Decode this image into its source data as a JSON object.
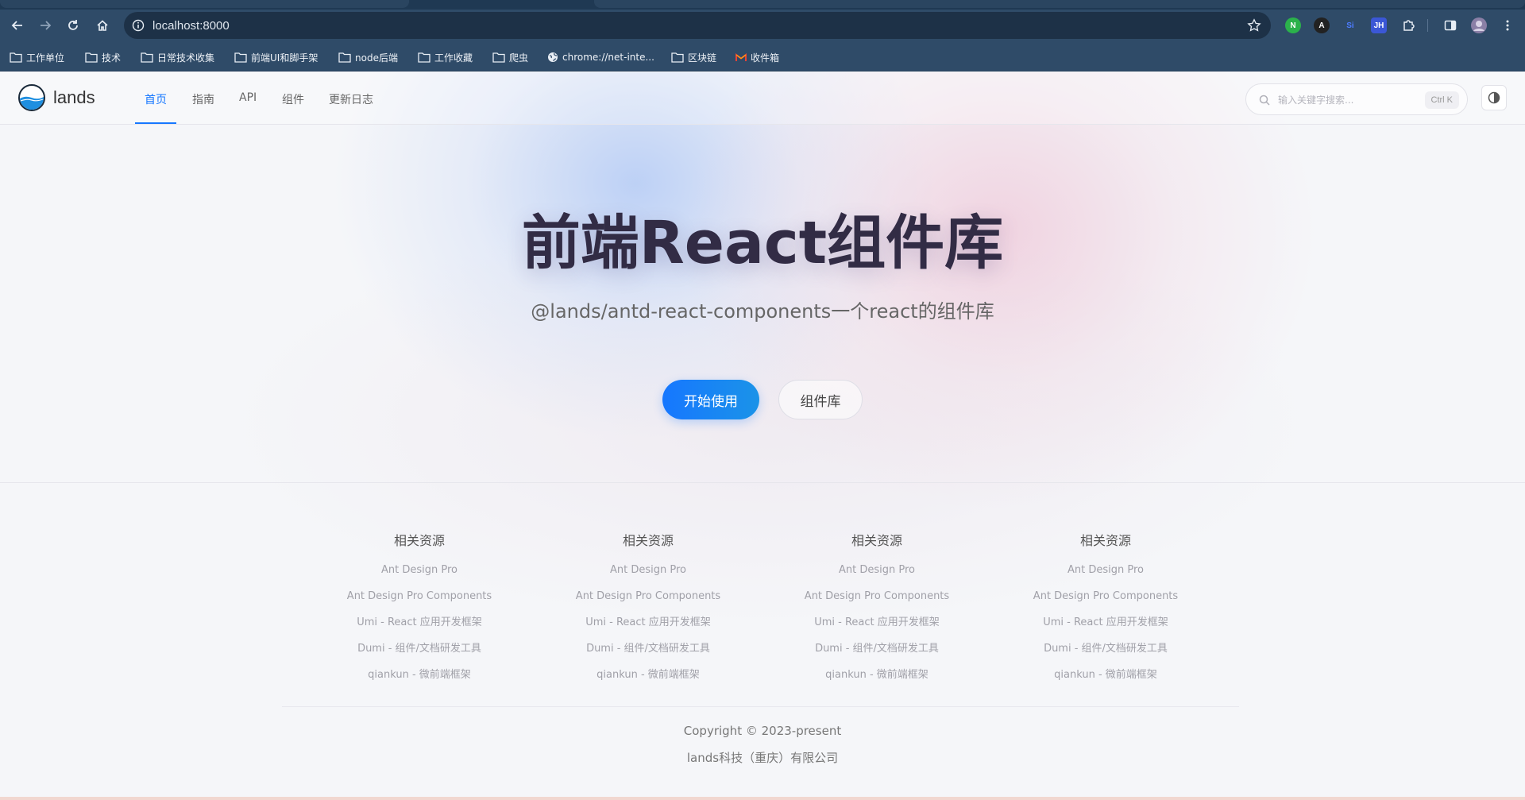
{
  "browser": {
    "url": "localhost:8000",
    "extensions": [
      {
        "icon": "extension-green-icon",
        "label": "N",
        "color": "#2bb14b"
      },
      {
        "icon": "extension-dark-icon",
        "label": "A",
        "color": "#222222"
      },
      {
        "icon": "extension-si-icon",
        "label": "Si",
        "color": "#2f4b68"
      },
      {
        "icon": "extension-jh-icon",
        "label": "JH",
        "color": "#3b57d6"
      }
    ]
  },
  "bookmarks": [
    {
      "label": "工作单位"
    },
    {
      "label": "技术"
    },
    {
      "label": "日常技术收集"
    },
    {
      "label": "前端UI和脚手架"
    },
    {
      "label": "node后端"
    },
    {
      "label": "工作收藏"
    },
    {
      "label": "爬虫"
    },
    {
      "label": "chrome://net-inte..."
    },
    {
      "label": "区块链"
    },
    {
      "label": "收件箱"
    }
  ],
  "nav": {
    "brand": "lands",
    "items": [
      {
        "label": "首页"
      },
      {
        "label": "指南"
      },
      {
        "label": "API"
      },
      {
        "label": "组件"
      },
      {
        "label": "更新日志"
      }
    ],
    "search": {
      "placeholder": "输入关键字搜索...",
      "shortcut": "Ctrl K"
    }
  },
  "hero": {
    "title": "前端React组件库",
    "subtitle": "@lands/antd-react-components一个react的组件库",
    "primary_button": "开始使用",
    "secondary_button": "组件库"
  },
  "footer": {
    "columns": [
      {
        "title": "相关资源",
        "links": [
          "Ant Design Pro",
          "Ant Design Pro Components",
          "Umi - React 应用开发框架",
          "Dumi - 组件/文档研发工具",
          "qiankun - 微前端框架"
        ]
      },
      {
        "title": "相关资源",
        "links": [
          "Ant Design Pro",
          "Ant Design Pro Components",
          "Umi - React 应用开发框架",
          "Dumi - 组件/文档研发工具",
          "qiankun - 微前端框架"
        ]
      },
      {
        "title": "相关资源",
        "links": [
          "Ant Design Pro",
          "Ant Design Pro Components",
          "Umi - React 应用开发框架",
          "Dumi - 组件/文档研发工具",
          "qiankun - 微前端框架"
        ]
      },
      {
        "title": "相关资源",
        "links": [
          "Ant Design Pro",
          "Ant Design Pro Components",
          "Umi - React 应用开发框架",
          "Dumi - 组件/文档研发工具",
          "qiankun - 微前端框架"
        ]
      }
    ],
    "copyright": "Copyright © 2023-present",
    "company": "lands科技（重庆）有限公司"
  }
}
